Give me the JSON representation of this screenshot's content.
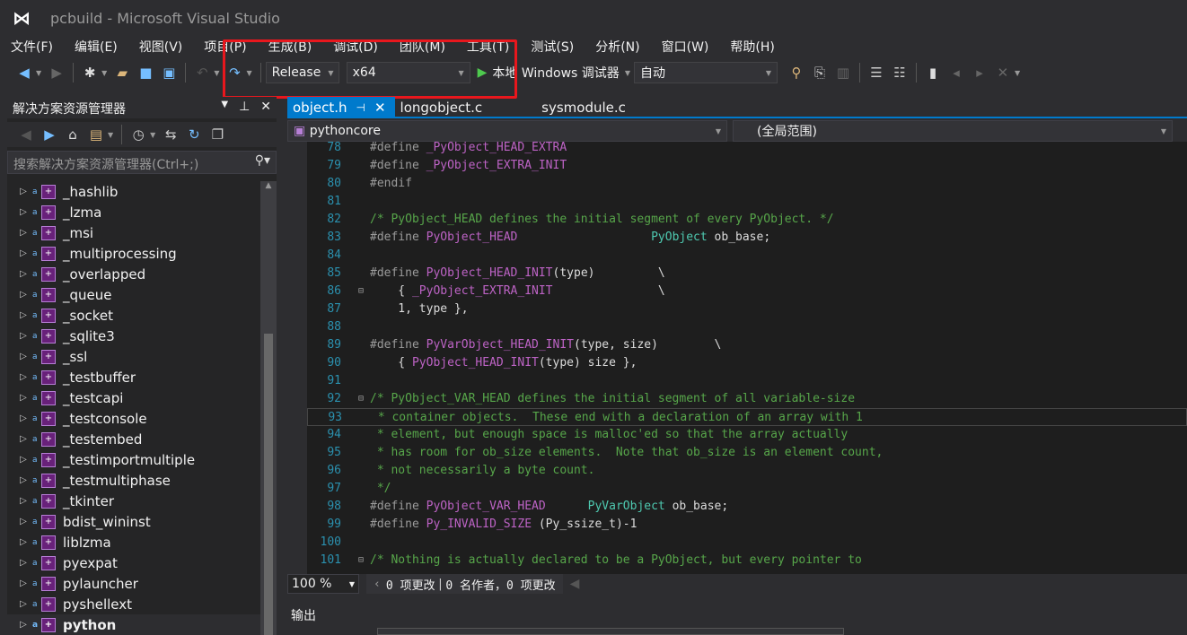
{
  "window": {
    "title": "pcbuild - Microsoft Visual Studio"
  },
  "menu": [
    "文件(F)",
    "编辑(E)",
    "视图(V)",
    "项目(P)",
    "生成(B)",
    "调试(D)",
    "团队(M)",
    "工具(T)",
    "测试(S)",
    "分析(N)",
    "窗口(W)",
    "帮助(H)"
  ],
  "toolbar": {
    "configuration": "Release",
    "platform": "x64",
    "debugger": "本地 Windows 调试器",
    "debug_mode": "自动"
  },
  "solution_explorer": {
    "title": "解决方案资源管理器",
    "search_placeholder": "搜索解决方案资源管理器(Ctrl+;)",
    "items": [
      "_hashlib",
      "_lzma",
      "_msi",
      "_multiprocessing",
      "_overlapped",
      "_queue",
      "_socket",
      "_sqlite3",
      "_ssl",
      "_testbuffer",
      "_testcapi",
      "_testconsole",
      "_testembed",
      "_testimportmultiple",
      "_testmultiphase",
      "_tkinter",
      "bdist_wininst",
      "liblzma",
      "pyexpat",
      "pylauncher",
      "pyshellext",
      "python"
    ],
    "startup_project": "python"
  },
  "tabs": [
    {
      "label": "object.h",
      "active": true
    },
    {
      "label": "longobject.c"
    },
    {
      "label": "sysmodule.c"
    }
  ],
  "navbar": {
    "project": "pythoncore",
    "scope": "(全局范围)"
  },
  "code": [
    {
      "n": "78",
      "segs": [
        [
          "pp",
          "#define "
        ],
        [
          "macro",
          "_PyObject_HEAD_EXTRA"
        ]
      ]
    },
    {
      "n": "79",
      "segs": [
        [
          "pp",
          "#define "
        ],
        [
          "macro",
          "_PyObject_EXTRA_INIT"
        ]
      ]
    },
    {
      "n": "80",
      "segs": [
        [
          "pp",
          "#endif"
        ]
      ]
    },
    {
      "n": "81",
      "segs": []
    },
    {
      "n": "82",
      "segs": [
        [
          "cmt",
          "/* PyObject_HEAD defines the initial segment of every PyObject. */"
        ]
      ]
    },
    {
      "n": "83",
      "segs": [
        [
          "pp",
          "#define "
        ],
        [
          "macro",
          "PyObject_HEAD"
        ],
        [
          "plain",
          "                   "
        ],
        [
          "type",
          "PyObject"
        ],
        [
          "plain",
          " ob_base;"
        ]
      ]
    },
    {
      "n": "84",
      "segs": []
    },
    {
      "n": "85",
      "segs": [
        [
          "pp",
          "#define "
        ],
        [
          "macro",
          "PyObject_HEAD_INIT"
        ],
        [
          "plain",
          "(type)         \\"
        ]
      ]
    },
    {
      "n": "86",
      "fold": "−",
      "segs": [
        [
          "plain",
          "    { "
        ],
        [
          "macro",
          "_PyObject_EXTRA_INIT"
        ],
        [
          "plain",
          "               \\"
        ]
      ]
    },
    {
      "n": "87",
      "segs": [
        [
          "plain",
          "    1, type },"
        ]
      ]
    },
    {
      "n": "88",
      "segs": []
    },
    {
      "n": "89",
      "segs": [
        [
          "pp",
          "#define "
        ],
        [
          "macro",
          "PyVarObject_HEAD_INIT"
        ],
        [
          "plain",
          "(type, size)        \\"
        ]
      ]
    },
    {
      "n": "90",
      "segs": [
        [
          "plain",
          "    { "
        ],
        [
          "macro",
          "PyObject_HEAD_INIT"
        ],
        [
          "plain",
          "(type) size },"
        ]
      ]
    },
    {
      "n": "91",
      "segs": []
    },
    {
      "n": "92",
      "fold": "−",
      "segs": [
        [
          "cmt",
          "/* PyObject_VAR_HEAD defines the initial segment of all variable-size"
        ]
      ]
    },
    {
      "n": "93",
      "current": true,
      "segs": [
        [
          "cmt",
          " * container objects.  These end with a declaration of an array with 1"
        ]
      ]
    },
    {
      "n": "94",
      "segs": [
        [
          "cmt",
          " * element, but enough space is malloc'ed so that the array actually"
        ]
      ]
    },
    {
      "n": "95",
      "segs": [
        [
          "cmt",
          " * has room for ob_size elements.  Note that ob_size is an element count,"
        ]
      ]
    },
    {
      "n": "96",
      "segs": [
        [
          "cmt",
          " * not necessarily a byte count."
        ]
      ]
    },
    {
      "n": "97",
      "segs": [
        [
          "cmt",
          " */"
        ]
      ]
    },
    {
      "n": "98",
      "segs": [
        [
          "pp",
          "#define "
        ],
        [
          "macro",
          "PyObject_VAR_HEAD"
        ],
        [
          "plain",
          "      "
        ],
        [
          "type",
          "PyVarObject"
        ],
        [
          "plain",
          " ob_base;"
        ]
      ]
    },
    {
      "n": "99",
      "segs": [
        [
          "pp",
          "#define "
        ],
        [
          "macro",
          "Py_INVALID_SIZE"
        ],
        [
          "plain",
          " (Py_ssize_t)-1"
        ]
      ]
    },
    {
      "n": "100",
      "segs": []
    },
    {
      "n": "101",
      "fold": "−",
      "segs": [
        [
          "cmt",
          "/* Nothing is actually declared to be a PyObject, but every pointer to"
        ]
      ]
    }
  ],
  "status": {
    "zoom": "100 %",
    "changes": "0 项更改",
    "authors": "0 名作者，0 项更改"
  },
  "output": {
    "title": "输出"
  },
  "colors": {
    "accent": "#007acc",
    "highlight_box": "#e8171d",
    "comment": "#57a64a",
    "macro": "#bd63c5",
    "type": "#4ec9b0",
    "line_number": "#2b91af"
  }
}
